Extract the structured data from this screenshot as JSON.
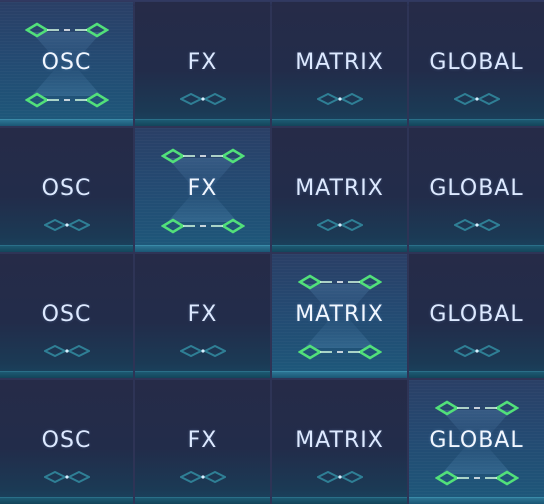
{
  "rows": [
    [
      {
        "label": "OSC",
        "active": true
      },
      {
        "label": "FX",
        "active": false
      },
      {
        "label": "MATRIX",
        "active": false
      },
      {
        "label": "GLOBAL",
        "active": false
      }
    ],
    [
      {
        "label": "OSC",
        "active": false
      },
      {
        "label": "FX",
        "active": true
      },
      {
        "label": "MATRIX",
        "active": false
      },
      {
        "label": "GLOBAL",
        "active": false
      }
    ],
    [
      {
        "label": "OSC",
        "active": false
      },
      {
        "label": "FX",
        "active": false
      },
      {
        "label": "MATRIX",
        "active": true
      },
      {
        "label": "GLOBAL",
        "active": false
      }
    ],
    [
      {
        "label": "OSC",
        "active": false
      },
      {
        "label": "FX",
        "active": false
      },
      {
        "label": "MATRIX",
        "active": false
      },
      {
        "label": "GLOBAL",
        "active": true
      }
    ]
  ],
  "icons": {
    "active": "green-diamond-bracket-icon",
    "inactive": "teal-diamond-pair-icon"
  },
  "colors": {
    "accent_green": "#52e07a",
    "inactive_teal": "#2f7f95",
    "label_text": "#dde9ff"
  }
}
